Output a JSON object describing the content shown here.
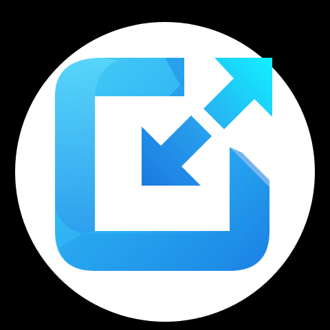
{
  "icon": {
    "name": "resize-expand-icon",
    "colors": {
      "background": "#000000",
      "circle": "#ffffff",
      "frame_light": "#3fc7f7",
      "frame_mid": "#29acf1",
      "frame_dark": "#1d86e6",
      "arrow_in": "#1f86e4",
      "arrow_out_light": "#14f0ff",
      "arrow_out_dark": "#22aef2"
    }
  }
}
